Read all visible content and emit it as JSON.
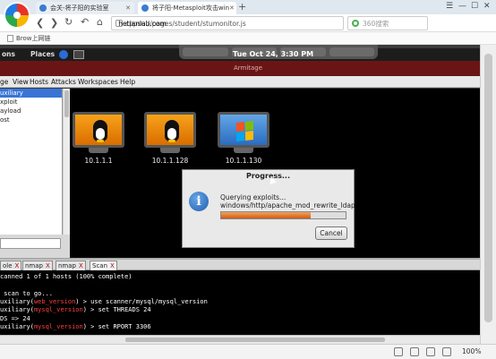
{
  "browser": {
    "tabs": [
      {
        "label": "会关-将子阳的实验室",
        "active": false
      },
      {
        "label": "将子阳-Metasploit攻击win",
        "active": true
      }
    ],
    "new_tab": "+",
    "window_controls": [
      "☰",
      "—",
      "☐",
      "✕"
    ],
    "nav": {
      "back": "❮",
      "forward": "❯",
      "reload": "↻",
      "undo": "↶",
      "home": "⌂"
    },
    "url_prefix": "cppsu.",
    "url_host": "hetianlab.com",
    "url_path": "//pages/student/stumonitor.js",
    "search_placeholder": "360搜索",
    "bookmark": "Brow上网链"
  },
  "desktop": {
    "panel_items": [
      "ons",
      "Places"
    ],
    "clock": "Tue Oct 24,  3:30 PM",
    "armitage_title": "Armitage",
    "menu": [
      "ge",
      "View",
      "Hosts",
      "Attacks",
      "Workspaces",
      "Help"
    ],
    "tree": [
      {
        "label": "uxiliary",
        "selected": true
      },
      {
        "label": "xploit",
        "selected": false
      },
      {
        "label": "ayload",
        "selected": false
      },
      {
        "label": "ost",
        "selected": false
      }
    ],
    "hosts": [
      {
        "ip": "10.1.1.1",
        "os": "linux"
      },
      {
        "ip": "10.1.1.128",
        "os": "linux"
      },
      {
        "ip": "10.1.1.130",
        "os": "windows"
      }
    ],
    "dialog": {
      "title": "Progress...",
      "icon": "i",
      "line1": "Querying exploits...",
      "line2": "windows/http/apache_mod_rewrite_ldap",
      "progress": 0.72,
      "cancel": "Cancel"
    },
    "console_tabs": [
      {
        "label": "ole",
        "active": false
      },
      {
        "label": "nmap",
        "active": false
      },
      {
        "label": "nmap",
        "active": false
      },
      {
        "label": "Scan",
        "active": true
      }
    ],
    "console_tab_close": "X",
    "console_lines": [
      {
        "a": "canned 1 of 1 hosts (100% complete)",
        "b": "",
        "c": ""
      },
      {
        "a": "",
        "b": "",
        "c": ""
      },
      {
        "a": " scan to go...",
        "b": "",
        "c": ""
      },
      {
        "a": "uxiliary(",
        "b": "web_version",
        "c": ") > use scanner/mysql/mysql_version"
      },
      {
        "a": "uxiliary(",
        "b": "mysql_version",
        "c": ") > set THREADS 24"
      },
      {
        "a": "DS => 24",
        "b": "",
        "c": ""
      },
      {
        "a": "uxiliary(",
        "b": "mysql_version",
        "c": ") > set RPORT 3306"
      }
    ]
  },
  "statusbar": {
    "zoom": "100%"
  },
  "colors": {
    "title_bar": "#6a1515",
    "progress": "#d05a12",
    "console_red": "#ff4040"
  }
}
